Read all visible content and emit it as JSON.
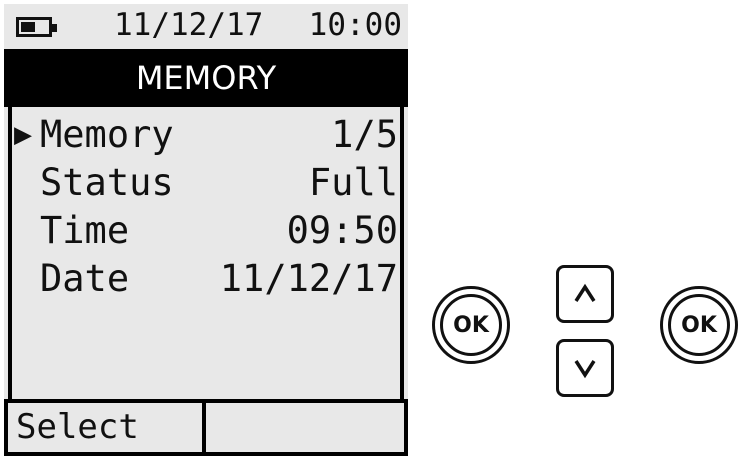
{
  "status_bar": {
    "battery_icon": "battery-low-icon",
    "date": "11/12/17",
    "time": "10:00"
  },
  "title": "MEMORY",
  "menu": {
    "cursor": "▶",
    "rows": [
      {
        "label": "Memory",
        "value": "1/5"
      },
      {
        "label": "Status",
        "value": "Full"
      },
      {
        "label": "Time",
        "value": "09:50"
      },
      {
        "label": "Date",
        "value": "11/12/17"
      }
    ]
  },
  "softkeys": {
    "left": "Select",
    "right": ""
  },
  "controls": {
    "ok_left_label": "OK",
    "ok_right_label": "OK",
    "up_icon": "chevron-up-icon",
    "down_icon": "chevron-down-icon"
  }
}
